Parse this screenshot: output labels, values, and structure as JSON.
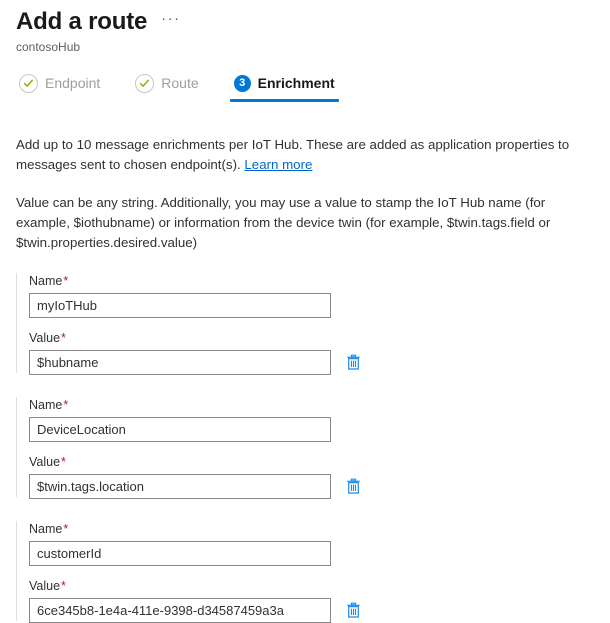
{
  "header": {
    "title": "Add a route",
    "subtitle": "contosoHub",
    "more_menu": "···",
    "more_menu_name": "more-options"
  },
  "tabs": [
    {
      "label": "Endpoint",
      "state": "completed",
      "indicator": "check-icon"
    },
    {
      "label": "Route",
      "state": "completed",
      "indicator": "check-icon"
    },
    {
      "label": "Enrichment",
      "state": "active",
      "indicator": "3"
    }
  ],
  "description": {
    "paragraph1_before_link": "Add up to 10 message enrichments per IoT Hub. These are added as application properties to messages sent to chosen endpoint(s). ",
    "link_text": "Learn more",
    "paragraph2": "Value can be any string. Additionally, you may use a value to stamp the IoT Hub name (for example, $iothubname) or information from the device twin (for example, $twin.tags.field or $twin.properties.desired.value)"
  },
  "labels": {
    "name": "Name",
    "value": "Value",
    "required_marker": "*",
    "delete_icon": "trash-icon"
  },
  "enrichments": [
    {
      "name_value": "myIoTHub",
      "value_value": "$hubname"
    },
    {
      "name_value": "DeviceLocation",
      "value_value": "$twin.tags.location"
    },
    {
      "name_value": "customerId",
      "value_value": "6ce345b8-1e4a-411e-9398-d34587459a3a"
    }
  ],
  "colors": {
    "accent": "#0078d4",
    "link": "#0066cc",
    "required": "#a4262c",
    "check_green": "#7fba00",
    "disabled_text": "#a19f9d",
    "border": "#8a8886"
  }
}
